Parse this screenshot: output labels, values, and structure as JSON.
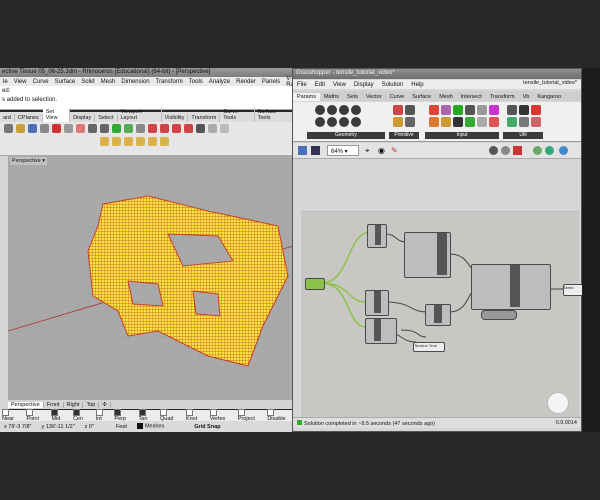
{
  "rhino": {
    "title": "ective Tissue 05_06-25.3dm - Rhinoceros (Educational) (64-bit) - [Perspective]",
    "menu": [
      "le",
      "View",
      "Curve",
      "Surface",
      "Solid",
      "Mesh",
      "Dimension",
      "Transform",
      "Tools",
      "Analyze",
      "Render",
      "Panels",
      "V-Ray"
    ],
    "command_lines": [
      "ed:",
      "s added to selection."
    ],
    "tabs": [
      "ard",
      "CPlanes",
      "Set View",
      "Display",
      "Select",
      "Viewport Layout",
      "Visibility",
      "Transform",
      "Curve Tools",
      "Surface Tools"
    ],
    "viewport_label": "Perspective",
    "viewport_tabs": [
      "Perspective",
      "Front",
      "Right",
      "Top"
    ],
    "osnaps": [
      {
        "label": "Near",
        "checked": false
      },
      {
        "label": "Point",
        "checked": false
      },
      {
        "label": "Mid",
        "checked": true
      },
      {
        "label": "Cen",
        "checked": true
      },
      {
        "label": "Int",
        "checked": false
      },
      {
        "label": "Perp",
        "checked": true
      },
      {
        "label": "Tan",
        "checked": true
      },
      {
        "label": "Quad",
        "checked": false
      },
      {
        "label": "Knot",
        "checked": false
      },
      {
        "label": "Vertex",
        "checked": false
      },
      {
        "label": "Project",
        "checked": false
      },
      {
        "label": "Disable",
        "checked": false
      }
    ],
    "status": {
      "x": "x 79'-3 7/8\"",
      "y": "y 136'-11 1/2\"",
      "z": "z 0\"",
      "units": "Feet",
      "layer": "Meshes",
      "snap": "Grid Snap"
    }
  },
  "grasshopper": {
    "title": "Grasshopper - tensile_tutorial_video*",
    "file_label": "tensile_tutorial_video*",
    "menu": [
      "File",
      "Edit",
      "View",
      "Display",
      "Solution",
      "Help"
    ],
    "tabs": [
      "Params",
      "Maths",
      "Sets",
      "Vector",
      "Curve",
      "Surface",
      "Mesh",
      "Intersect",
      "Transform",
      "Vb",
      "Kangaroo"
    ],
    "groups": [
      "Geometry",
      "Primitive",
      "Input",
      "Util"
    ],
    "zoom": "64%",
    "status_text": "Solution completed in ~9.5 seconds (47 seconds ago)",
    "version": "0.9.0014",
    "nodes": {
      "mesh": "Mesh",
      "tension": "Tension",
      "true_label": "True"
    }
  },
  "colors": {
    "rhino_bg": "#a9a9a9",
    "mesh_yellow": "#f4e63a",
    "mesh_red": "#c8402a",
    "gh_canvas": "#c9c7c3",
    "wire_green": "#8bc34a"
  }
}
